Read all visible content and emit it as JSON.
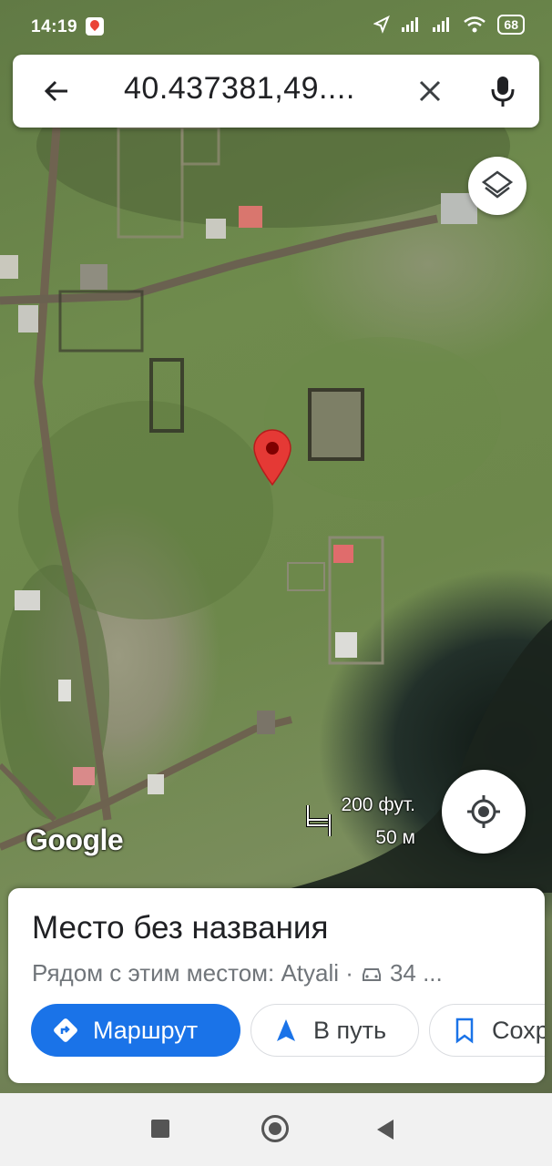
{
  "status_bar": {
    "time": "14:19",
    "app_icon": "google-maps-icon",
    "icons": [
      "location-arrow-icon",
      "signal-icon",
      "signal-icon",
      "wifi-icon"
    ],
    "battery": "68"
  },
  "search": {
    "query": "40.437381,49....",
    "back_icon": "arrow-back-icon",
    "clear_icon": "close-icon",
    "voice_icon": "mic-icon"
  },
  "map": {
    "layers_icon": "layers-icon",
    "pin_icon": "map-pin-icon",
    "pin_color": "#e53935",
    "scale_top": "200 фут.",
    "scale_bottom": "50 м",
    "logo": "Google",
    "locate_icon": "my-location-icon"
  },
  "place": {
    "title": "Место без названия",
    "subtitle": "Рядом с этим местом: Atyali ·",
    "drive_icon": "car-icon",
    "drive_time": "34 ...",
    "buttons": {
      "route": "Маршрут",
      "go": "В путь",
      "save": "Сохр"
    }
  },
  "colors": {
    "accent": "#1a73e8",
    "pin": "#e53935"
  },
  "navbar": {
    "recent_icon": "recent-apps-icon",
    "home_icon": "home-icon",
    "back_icon": "back-triangle-icon"
  }
}
